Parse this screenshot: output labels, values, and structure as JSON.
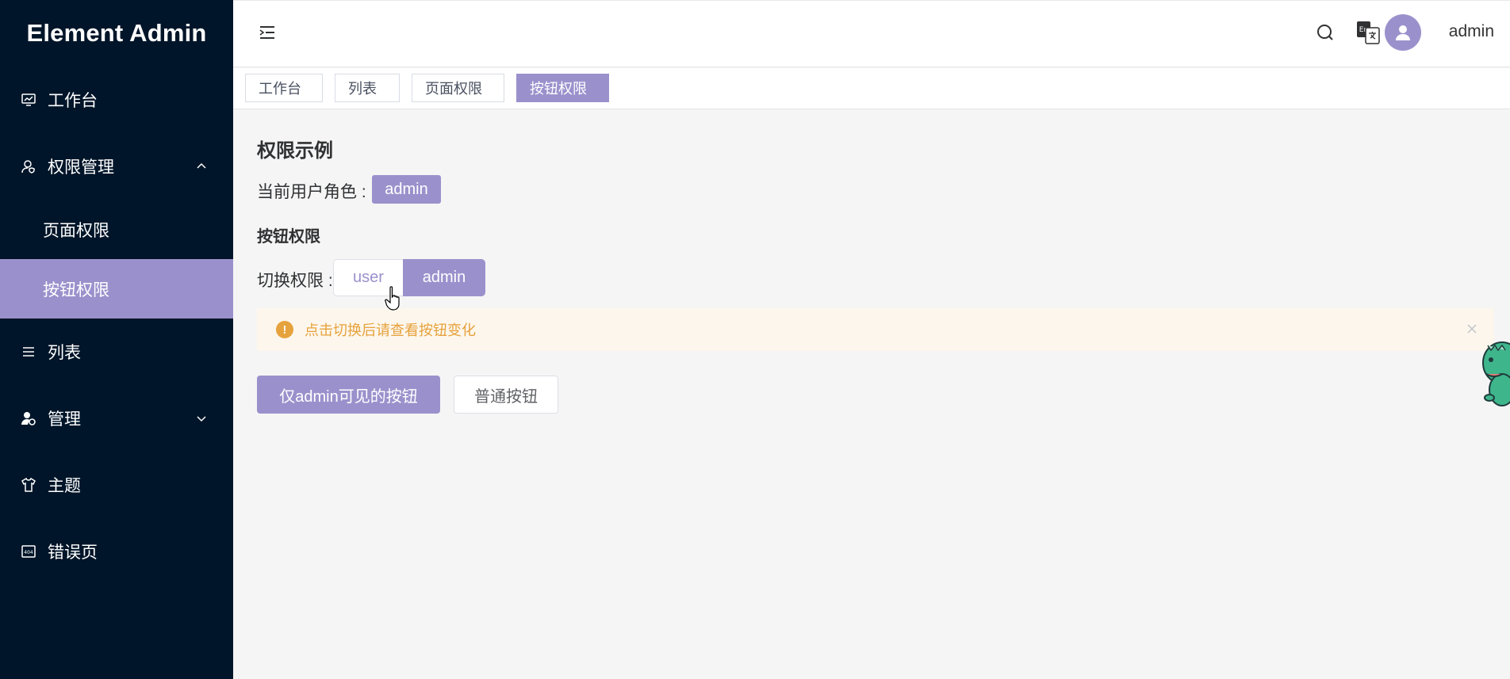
{
  "sidebar": {
    "logo": "Element Admin",
    "items": [
      {
        "label": "工作台",
        "icon": "monitor-chart-icon"
      },
      {
        "label": "权限管理",
        "icon": "user-shield-icon",
        "expanded": true,
        "children": [
          {
            "label": "页面权限",
            "active": false
          },
          {
            "label": "按钮权限",
            "active": true
          }
        ]
      },
      {
        "label": "列表",
        "icon": "list-icon"
      },
      {
        "label": "管理",
        "icon": "user-gear-icon",
        "expanded": false
      },
      {
        "label": "主题",
        "icon": "tshirt-icon"
      },
      {
        "label": "错误页",
        "icon": "error-404-icon"
      }
    ]
  },
  "header": {
    "username": "admin",
    "lang_icon_text": "En"
  },
  "tags": [
    {
      "label": "工作台",
      "active": false
    },
    {
      "label": "列表",
      "active": false
    },
    {
      "label": "页面权限",
      "active": false
    },
    {
      "label": "按钮权限",
      "active": true
    }
  ],
  "main": {
    "title": "权限示例",
    "role_label": "当前用户角色 :",
    "role_value": "admin",
    "subtitle": "按钮权限",
    "switch_label": "切换权限 :",
    "switch_options": [
      "user",
      "admin"
    ],
    "switch_selected": "admin",
    "alert_text": "点击切换后请查看按钮变化",
    "btn_admin": "仅admin可见的按钮",
    "btn_normal": "普通按钮"
  },
  "colors": {
    "primary": "#9a91cc",
    "sidebar_bg": "#001529",
    "warning": "#e6a23c",
    "warning_bg": "#fdf6ec"
  }
}
